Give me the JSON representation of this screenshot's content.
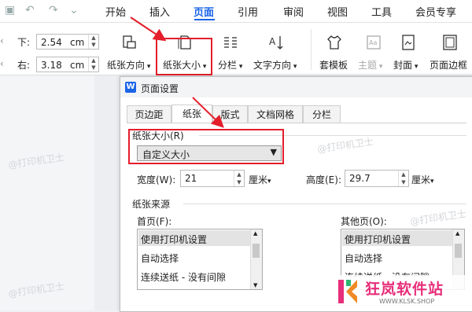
{
  "menu": {
    "tabs": [
      "开始",
      "插入",
      "页面",
      "引用",
      "审阅",
      "视图",
      "工具",
      "会员专享"
    ],
    "active_index": 2
  },
  "ribbon": {
    "margin_bottom_label": "下:",
    "margin_bottom_value": "2.54",
    "margin_right_label": "右:",
    "margin_right_value": "3.18",
    "unit": "cm",
    "buttons": {
      "orientation": "纸张方向",
      "paper_size": "纸张大小",
      "columns": "分栏",
      "text_direction": "文字方向",
      "template": "套模板",
      "theme": "主题",
      "cover": "封面",
      "page_border": "页面边框"
    }
  },
  "dialog": {
    "title": "页面设置",
    "tabs": [
      "页边距",
      "纸张",
      "版式",
      "文档网格",
      "分栏"
    ],
    "selected_tab": 1,
    "paper_size_label": "纸张大小(R)",
    "paper_size_value": "自定义大小",
    "width_label": "宽度(W):",
    "width_value": "21",
    "height_label": "高度(E):",
    "height_value": "29.7",
    "unit": "厘米",
    "paper_source_label": "纸张来源",
    "first_page_label": "首页(F):",
    "other_pages_label": "其他页(O):",
    "first_page_options": [
      "使用打印机设置",
      "自动选择",
      "连续送纸 - 没有间隙"
    ],
    "other_pages_options": [
      "使用打印机设置",
      "自动选择",
      "连续送纸 - 没有间隙"
    ]
  },
  "watermark": "@打印机卫士",
  "brand": {
    "name": "狂岚软件站",
    "url": "WWW.KLSK.SHOP"
  },
  "colors": {
    "accent": "#1a64e8",
    "highlight": "#e41e2b",
    "brand_pink": "#e62e7a"
  }
}
